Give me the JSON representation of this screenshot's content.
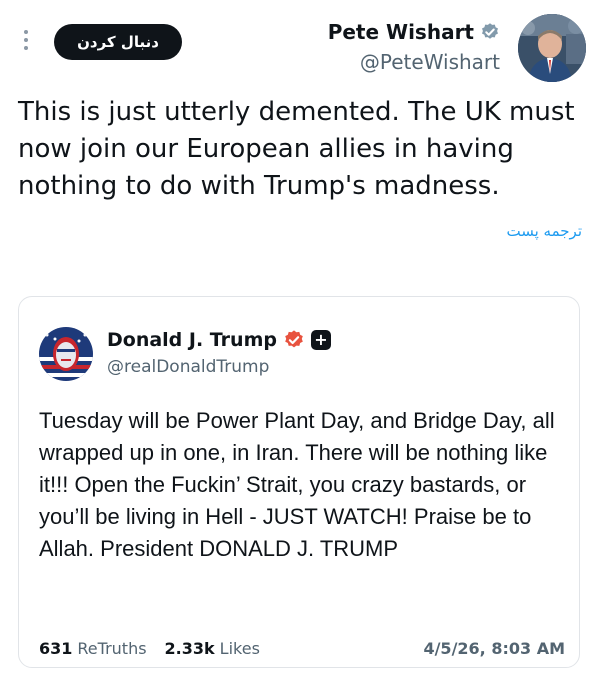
{
  "header": {
    "follow_label": "دنبال کردن",
    "author_name": "Pete Wishart",
    "author_handle": "@PeteWishart"
  },
  "tweet": {
    "text": "This is just utterly demented. The UK must now join our European allies in having nothing to do with Trump's madness.",
    "translate_label": "ترجمه پست"
  },
  "quote": {
    "name": "Donald J. Trump",
    "handle": "@realDonaldTrump",
    "text": "Tuesday will be Power Plant Day, and Bridge Day, all wrapped up in one, in Iran. There will be nothing like it!!! Open the Fuckin’ Strait, you crazy bastards, or you’ll be living in Hell - JUST WATCH! Praise be to Allah. President DONALD J. TRUMP",
    "retruths_count": "631",
    "retruths_label": "ReTruths",
    "likes_count": "2.33k",
    "likes_label": "Likes",
    "date": "4/5/26, 8:03 AM"
  },
  "icons": {
    "more": "more-vertical-icon",
    "verified": "verified-badge-icon",
    "plus": "plus-badge-icon"
  },
  "colors": {
    "accent": "#1d9bf0",
    "truth_badge": "#e8533f",
    "text_secondary": "#536471",
    "follow_bg": "#0f1419"
  }
}
